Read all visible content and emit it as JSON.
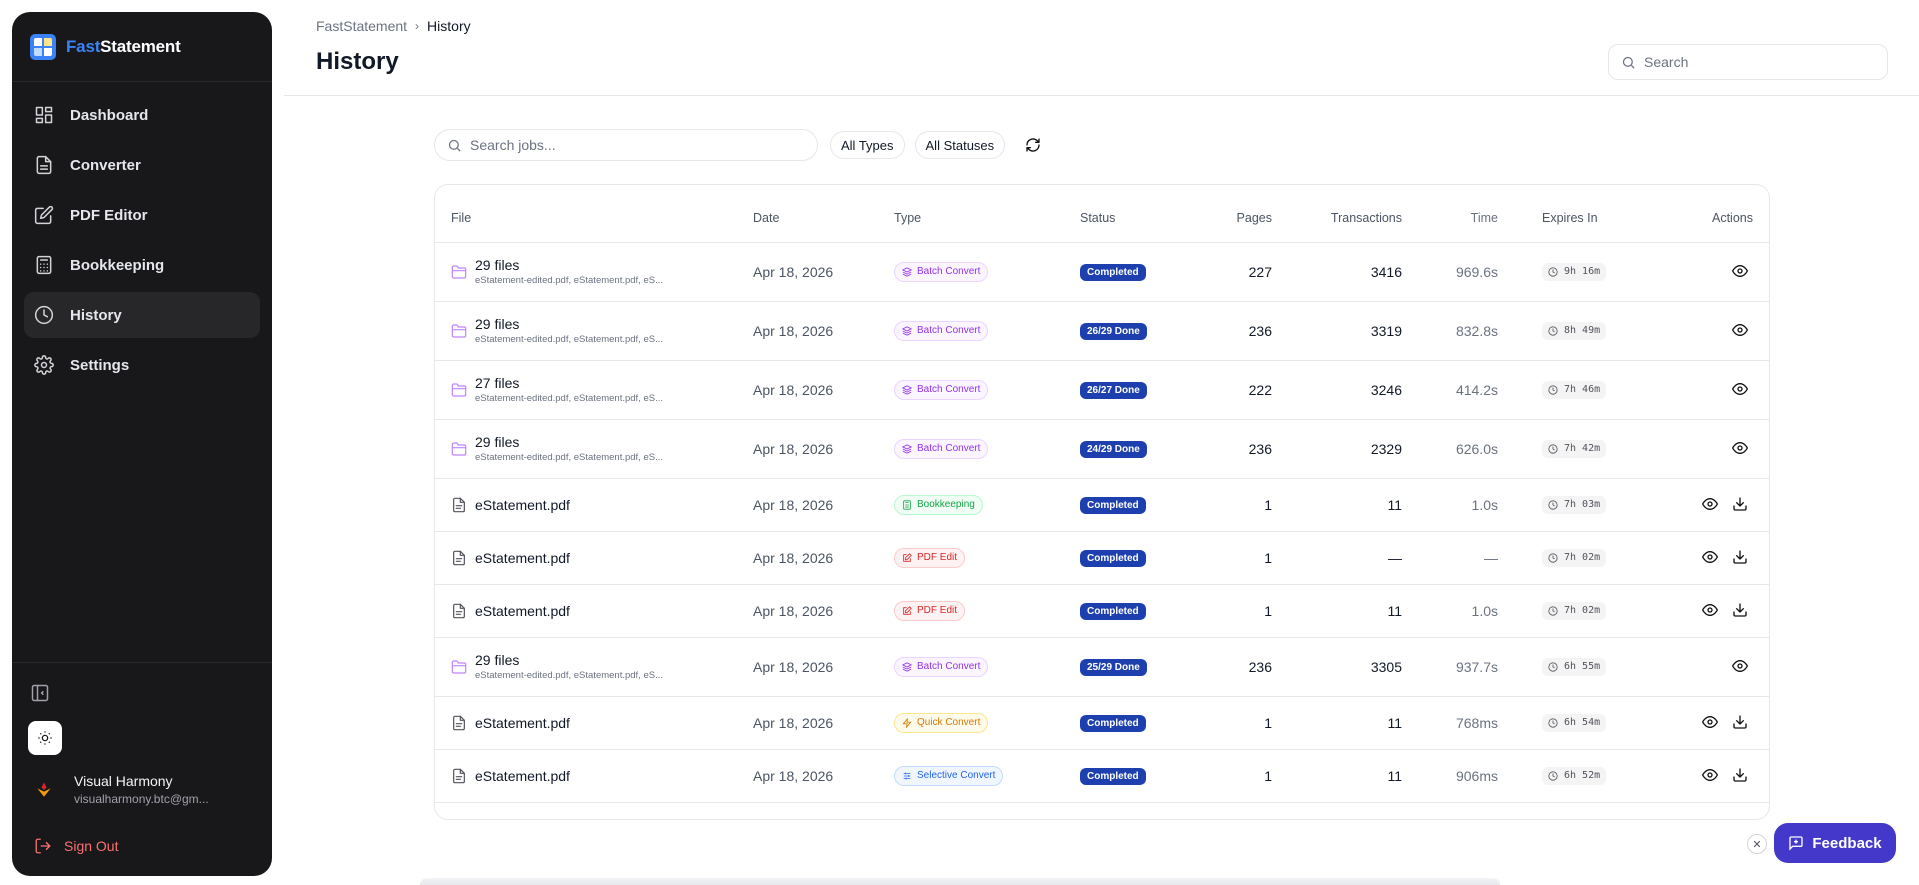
{
  "app": {
    "brand_prefix": "Fast",
    "brand_suffix": "Statement"
  },
  "nav": [
    {
      "label": "Dashboard",
      "icon": "dashboard-icon"
    },
    {
      "label": "Converter",
      "icon": "file-icon"
    },
    {
      "label": "PDF Editor",
      "icon": "edit-icon"
    },
    {
      "label": "Bookkeeping",
      "icon": "calculator-icon"
    },
    {
      "label": "History",
      "icon": "clock-icon",
      "active": true
    },
    {
      "label": "Settings",
      "icon": "gear-icon"
    }
  ],
  "user": {
    "name": "Visual Harmony",
    "email": "visualharmony.btc@gm..."
  },
  "signout_label": "Sign Out",
  "breadcrumb": {
    "root": "FastStatement",
    "current": "History"
  },
  "page_title": "History",
  "top_search": {
    "placeholder": "Search"
  },
  "filters": {
    "search_placeholder": "Search jobs...",
    "types": "All Types",
    "statuses": "All Statuses"
  },
  "table": {
    "headers": [
      "File",
      "Date",
      "Type",
      "Status",
      "Pages",
      "Transactions",
      "Time",
      "Expires In",
      "Actions"
    ],
    "rows": [
      {
        "kind": "batch",
        "name": "29 files",
        "sub": "eStatement-edited.pdf, eStatement.pdf, eS...",
        "date": "Apr 18, 2026",
        "type": "Batch Convert",
        "status": "Completed",
        "pages": "227",
        "tx": "3416",
        "time": "969.6s",
        "expires": "9h 16m"
      },
      {
        "kind": "batch",
        "name": "29 files",
        "sub": "eStatement-edited.pdf, eStatement.pdf, eS...",
        "date": "Apr 18, 2026",
        "type": "Batch Convert",
        "status": "26/29 Done",
        "pages": "236",
        "tx": "3319",
        "time": "832.8s",
        "expires": "8h 49m"
      },
      {
        "kind": "batch",
        "name": "27 files",
        "sub": "eStatement-edited.pdf, eStatement.pdf, eS...",
        "date": "Apr 18, 2026",
        "type": "Batch Convert",
        "status": "26/27 Done",
        "pages": "222",
        "tx": "3246",
        "time": "414.2s",
        "expires": "7h 46m"
      },
      {
        "kind": "batch",
        "name": "29 files",
        "sub": "eStatement-edited.pdf, eStatement.pdf, eS...",
        "date": "Apr 18, 2026",
        "type": "Batch Convert",
        "status": "24/29 Done",
        "pages": "236",
        "tx": "2329",
        "time": "626.0s",
        "expires": "7h 42m"
      },
      {
        "kind": "single",
        "name": "eStatement.pdf",
        "sub": "",
        "date": "Apr 18, 2026",
        "type": "Bookkeeping",
        "status": "Completed",
        "pages": "1",
        "tx": "11",
        "time": "1.0s",
        "expires": "7h 03m"
      },
      {
        "kind": "single",
        "name": "eStatement.pdf",
        "sub": "",
        "date": "Apr 18, 2026",
        "type": "PDF Edit",
        "status": "Completed",
        "pages": "1",
        "tx": "—",
        "time": "—",
        "expires": "7h 02m"
      },
      {
        "kind": "single",
        "name": "eStatement.pdf",
        "sub": "",
        "date": "Apr 18, 2026",
        "type": "PDF Edit",
        "status": "Completed",
        "pages": "1",
        "tx": "11",
        "time": "1.0s",
        "expires": "7h 02m"
      },
      {
        "kind": "batch",
        "name": "29 files",
        "sub": "eStatement-edited.pdf, eStatement.pdf, eS...",
        "date": "Apr 18, 2026",
        "type": "Batch Convert",
        "status": "25/29 Done",
        "pages": "236",
        "tx": "3305",
        "time": "937.7s",
        "expires": "6h 55m"
      },
      {
        "kind": "single",
        "name": "eStatement.pdf",
        "sub": "",
        "date": "Apr 18, 2026",
        "type": "Quick Convert",
        "status": "Completed",
        "pages": "1",
        "tx": "11",
        "time": "768ms",
        "expires": "6h 54m"
      },
      {
        "kind": "single",
        "name": "eStatement.pdf",
        "sub": "",
        "date": "Apr 18, 2026",
        "type": "Selective Convert",
        "status": "Completed",
        "pages": "1",
        "tx": "11",
        "time": "906ms",
        "expires": "6h 52m"
      }
    ]
  },
  "feedback_label": "Feedback",
  "close_glyph": "✕",
  "colors": {
    "accent": "#4338ca",
    "status": "#1e40af",
    "sidebar": "#18181b",
    "brand": "#3b82f6"
  }
}
